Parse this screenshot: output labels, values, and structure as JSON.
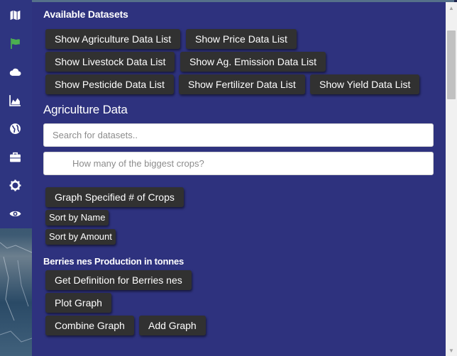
{
  "icons": [
    "map-icon",
    "flag-icon",
    "cloud-icon",
    "area-chart-icon",
    "globe-icon",
    "briefcase-icon",
    "gear-icon",
    "eye-icon"
  ],
  "datasets": {
    "title": "Available Datasets",
    "buttons": [
      "Show Agriculture Data List",
      "Show Price Data List",
      "Show Livestock Data List",
      "Show Ag. Emission Data List",
      "Show Pesticide Data List",
      "Show Fertilizer Data List",
      "Show Yield Data List"
    ]
  },
  "agriculture": {
    "title": "Agriculture Data",
    "search_placeholder": "Search for datasets..",
    "crops_placeholder": "How many of the biggest crops?",
    "graph_button": "Graph Specified # of Crops",
    "sort_name": "Sort by Name",
    "sort_amount": "Sort by Amount"
  },
  "production": {
    "title": "Berries nes Production in tonnes",
    "definition_button": "Get Definition for Berries nes",
    "plot_button": "Plot Graph",
    "combine_button": "Combine Graph",
    "add_button": "Add Graph"
  },
  "colors": {
    "panel": "#2e327e",
    "button": "#313131",
    "flag_active": "#4caf50"
  }
}
